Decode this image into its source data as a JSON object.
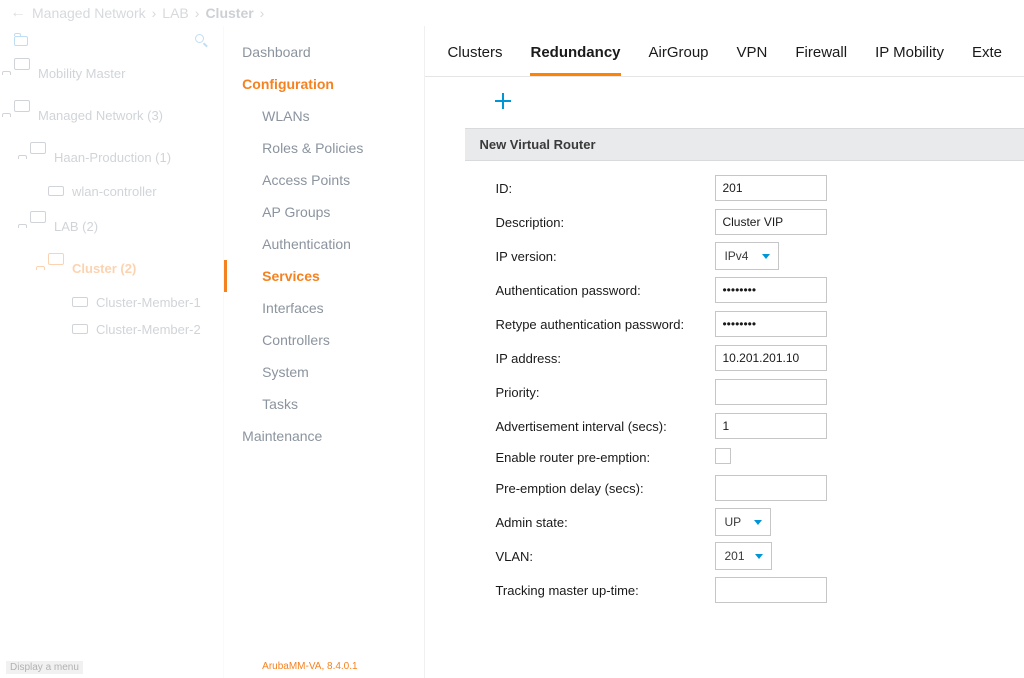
{
  "breadcrumb": {
    "back_icon": "←",
    "items": [
      "Managed Network",
      "LAB",
      "Cluster"
    ]
  },
  "tree": {
    "search_icon": "folder-search",
    "magnify_icon": "search",
    "items": [
      {
        "label": "Mobility Master",
        "depth": 0,
        "icon": "folder"
      },
      {
        "label": "Managed Network (3)",
        "depth": 0,
        "icon": "folder"
      },
      {
        "label": "Haan-Production (1)",
        "depth": 1,
        "icon": "folder"
      },
      {
        "label": "wlan-controller",
        "depth": 2,
        "icon": "device"
      },
      {
        "label": "LAB (2)",
        "depth": 1,
        "icon": "folder"
      },
      {
        "label": "Cluster (2)",
        "depth": 2,
        "icon": "folder",
        "selected": true
      },
      {
        "label": "Cluster-Member-1",
        "depth": 3,
        "icon": "device"
      },
      {
        "label": "Cluster-Member-2",
        "depth": 3,
        "icon": "device"
      }
    ]
  },
  "menu": {
    "items": [
      {
        "label": "Dashboard",
        "type": "top"
      },
      {
        "label": "Configuration",
        "type": "section"
      },
      {
        "label": "WLANs",
        "type": "child"
      },
      {
        "label": "Roles & Policies",
        "type": "child"
      },
      {
        "label": "Access Points",
        "type": "child"
      },
      {
        "label": "AP Groups",
        "type": "child"
      },
      {
        "label": "Authentication",
        "type": "child"
      },
      {
        "label": "Services",
        "type": "child",
        "selected": true
      },
      {
        "label": "Interfaces",
        "type": "child"
      },
      {
        "label": "Controllers",
        "type": "child"
      },
      {
        "label": "System",
        "type": "child"
      },
      {
        "label": "Tasks",
        "type": "child"
      },
      {
        "label": "Maintenance",
        "type": "top"
      }
    ],
    "footer": "ArubaMM-VA, 8.4.0.1"
  },
  "tabs": [
    "Clusters",
    "Redundancy",
    "AirGroup",
    "VPN",
    "Firewall",
    "IP Mobility",
    "Exte"
  ],
  "active_tab": "Redundancy",
  "section_title": "New Virtual Router",
  "form": {
    "id": {
      "label": "ID:",
      "value": "201"
    },
    "description": {
      "label": "Description:",
      "value": "Cluster VIP"
    },
    "ip_version": {
      "label": "IP version:",
      "value": "IPv4"
    },
    "auth_pw": {
      "label": "Authentication password:",
      "value": "••••••••"
    },
    "auth_pw2": {
      "label": "Retype authentication password:",
      "value": "••••••••"
    },
    "ip_addr": {
      "label": "IP address:",
      "value": "10.201.201.10"
    },
    "priority": {
      "label": "Priority:",
      "value": ""
    },
    "adv_interval": {
      "label": "Advertisement interval (secs):",
      "value": "1"
    },
    "preemption": {
      "label": "Enable router pre-emption:"
    },
    "preempt_delay": {
      "label": "Pre-emption delay (secs):",
      "value": ""
    },
    "admin_state": {
      "label": "Admin state:",
      "value": "UP"
    },
    "vlan": {
      "label": "VLAN:",
      "value": "201"
    },
    "tracking": {
      "label": "Tracking master up-time:",
      "value": ""
    }
  },
  "status_hint": "Display a menu"
}
